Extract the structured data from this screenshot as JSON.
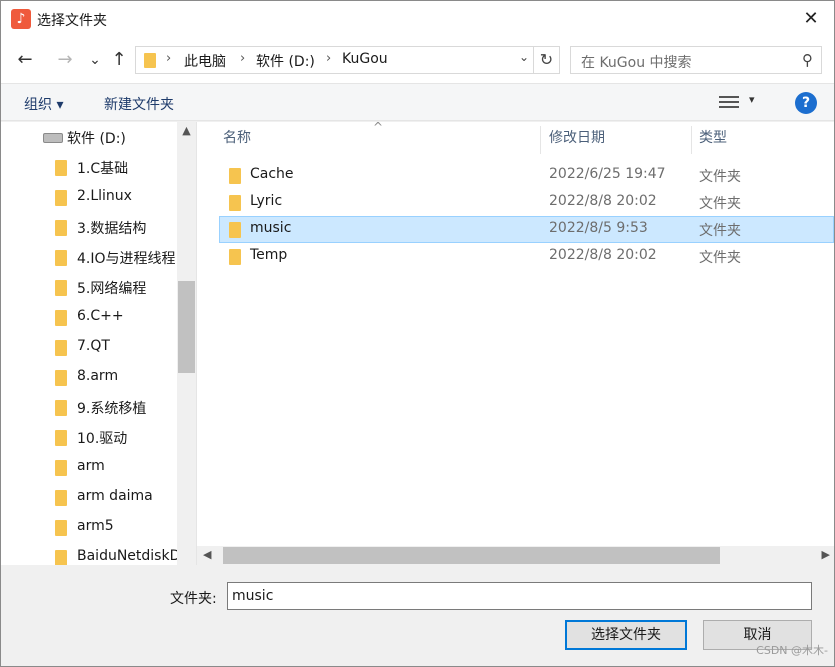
{
  "window": {
    "title": "选择文件夹",
    "app_icon_glyph": "♪",
    "close_glyph": "✕"
  },
  "nav": {
    "back_glyph": "←",
    "forward_glyph": "→",
    "history_glyph": "⌄",
    "up_glyph": "↑",
    "breadcrumb": [
      "此电脑",
      "软件 (D:)",
      "KuGou"
    ],
    "separator": "›",
    "dropdown_glyph": "⌄",
    "refresh_glyph": "↻",
    "search_placeholder": "在 KuGou 中搜索",
    "search_glyph": "⚲"
  },
  "toolbar": {
    "organize": "组织 ▾",
    "new_folder": "新建文件夹",
    "view_drop": "▾",
    "help": "?"
  },
  "sidebar": {
    "drive": "软件 (D:)",
    "items": [
      "1.C基础",
      "2.Llinux",
      "3.数据结构",
      "4.IO与进程线程",
      "5.网络编程",
      "6.C++",
      "7.QT",
      "8.arm",
      "9.系统移植",
      "10.驱动",
      "arm",
      "arm daima",
      "arm5",
      "BaiduNetdiskDownload"
    ],
    "scroll_up": "▲"
  },
  "list": {
    "columns": {
      "name": "名称",
      "date": "修改日期",
      "type": "类型"
    },
    "sort_glyph": "^",
    "rows": [
      {
        "name": "Cache",
        "date": "2022/6/25 19:47",
        "type": "文件夹",
        "selected": false
      },
      {
        "name": "Lyric",
        "date": "2022/8/8 20:02",
        "type": "文件夹",
        "selected": false
      },
      {
        "name": "music",
        "date": "2022/8/5 9:53",
        "type": "文件夹",
        "selected": true
      },
      {
        "name": "Temp",
        "date": "2022/8/8 20:02",
        "type": "文件夹",
        "selected": false
      }
    ],
    "scroll_left": "◀",
    "scroll_right": "▶"
  },
  "footer": {
    "folder_label": "文件夹:",
    "folder_value": "music",
    "select_button": "选择文件夹",
    "cancel_button": "取消"
  },
  "watermark": "CSDN @木木-"
}
